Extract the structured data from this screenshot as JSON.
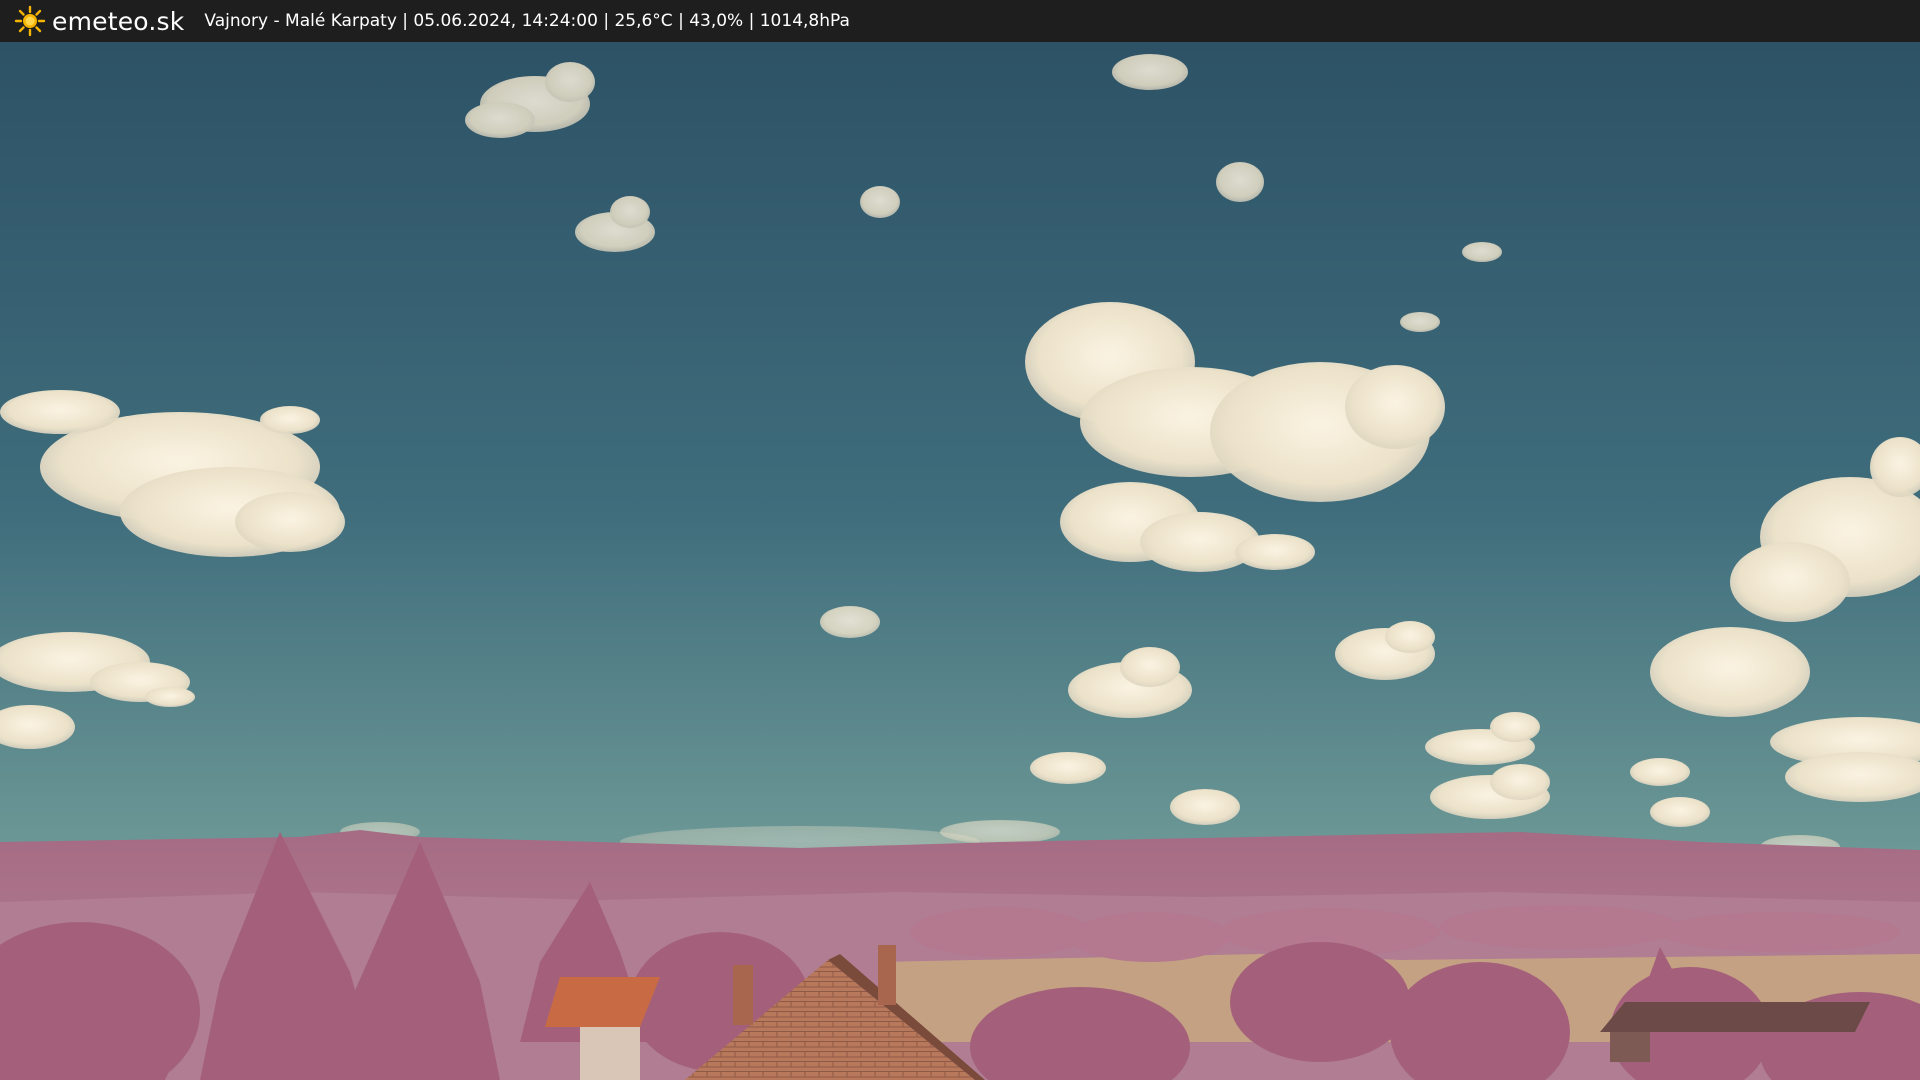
{
  "header": {
    "brand": "emeteo.sk",
    "logo_icon": "sun-icon",
    "caption": "Vajnory - Malé Karpaty | 05.06.2024, 14:24:00 | 25,6°C | 43,0% | 1014,8hPa"
  },
  "colors": {
    "bar_background": "#1e1e1e",
    "sky_top": "#2f5668",
    "sky_bottom": "#6f9a98",
    "hills": "#a86d86",
    "trees": "#a0566f",
    "roof": "#c86a44",
    "field": "#c9a27f",
    "sun": "#f5b400"
  }
}
